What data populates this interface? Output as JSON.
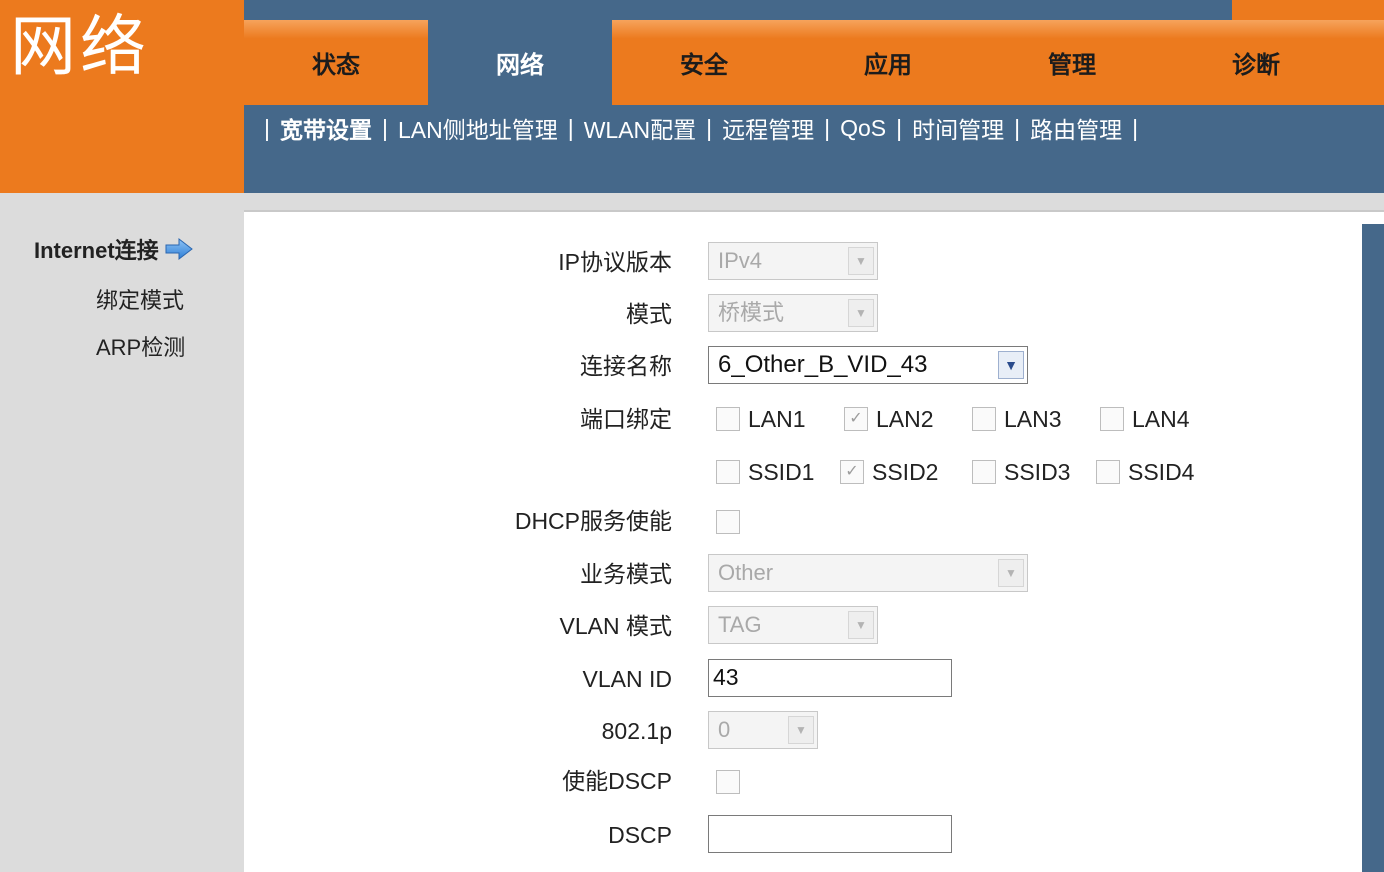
{
  "header": {
    "brand": "网络",
    "tabs": [
      {
        "label": "状态"
      },
      {
        "label": "网络"
      },
      {
        "label": "安全"
      },
      {
        "label": "应用"
      },
      {
        "label": "管理"
      },
      {
        "label": "诊断"
      }
    ],
    "subnav": [
      "宽带设置",
      "LAN侧地址管理",
      "WLAN配置",
      "远程管理",
      "QoS",
      "时间管理",
      "路由管理"
    ],
    "separator": "|"
  },
  "sidebar": {
    "items": [
      {
        "label": "Internet连接",
        "active": true,
        "icon": "arrow-right-icon"
      },
      {
        "label": "绑定模式"
      },
      {
        "label": "ARP检测"
      }
    ]
  },
  "form": {
    "ip_version": {
      "label": "IP协议版本",
      "value": "IPv4"
    },
    "mode": {
      "label": "模式",
      "value": "桥模式"
    },
    "connection_name": {
      "label": "连接名称",
      "value": "6_Other_B_VID_43"
    },
    "port_binding": {
      "label": "端口绑定",
      "ports": [
        {
          "name": "LAN1",
          "checked": false
        },
        {
          "name": "LAN2",
          "checked": true
        },
        {
          "name": "LAN3",
          "checked": false
        },
        {
          "name": "LAN4",
          "checked": false
        },
        {
          "name": "SSID1",
          "checked": false
        },
        {
          "name": "SSID2",
          "checked": true
        },
        {
          "name": "SSID3",
          "checked": false
        },
        {
          "name": "SSID4",
          "checked": false
        }
      ]
    },
    "dhcp": {
      "label": "DHCP服务使能",
      "checked": false
    },
    "service_mode": {
      "label": "业务模式",
      "value": "Other"
    },
    "vlan_mode": {
      "label": "VLAN 模式",
      "value": "TAG"
    },
    "vlan_id": {
      "label": "VLAN ID",
      "value": "43"
    },
    "priority": {
      "label": "802.1p",
      "value": "0"
    },
    "enable_dscp": {
      "label": "使能DSCP",
      "checked": false
    },
    "dscp": {
      "label": "DSCP",
      "value": ""
    }
  },
  "colors": {
    "orange": "#ec7a1e",
    "blue": "#45688a",
    "panel_bg": "#ffffff",
    "sidebar_bg": "#dcdcdc"
  },
  "icons": {
    "check": "✓",
    "caret": "▼"
  }
}
